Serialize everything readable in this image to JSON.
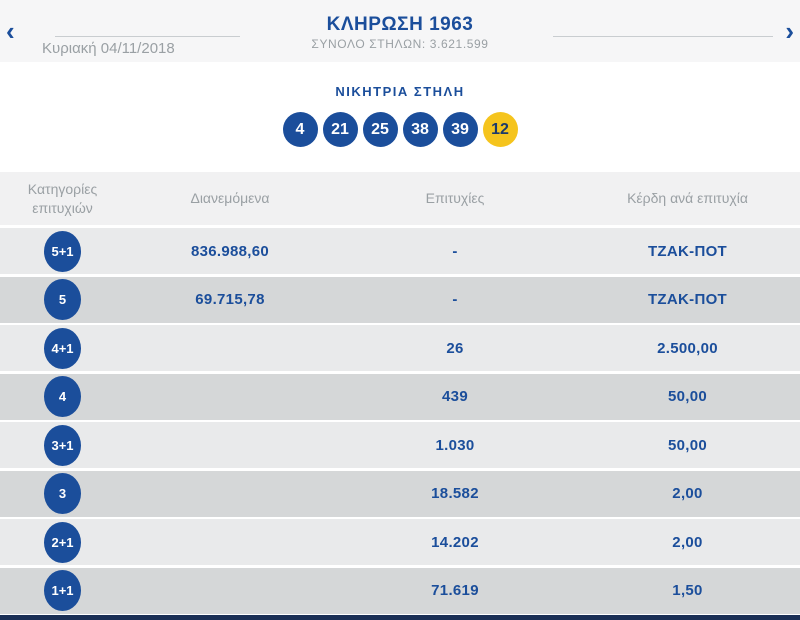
{
  "header": {
    "title": "ΚΛΗΡΩΣΗ 1963",
    "subtitle": "ΣΥΝΟΛΟ ΣΤΗΛΩΝ: 3.621.599",
    "date": "Κυριακή 04/11/2018",
    "prev_icon": "‹",
    "next_icon": "›"
  },
  "winning": {
    "title": "ΝΙΚΗΤΡΙΑ ΣΤΗΛΗ",
    "numbers": [
      "4",
      "21",
      "25",
      "38",
      "39"
    ],
    "bonus": "12"
  },
  "colors": {
    "navy": "#1b4e9b",
    "yellow": "#f5c41d",
    "footer_bar": "#1a2f55"
  },
  "table": {
    "headers": {
      "category_line1": "Κατηγορίες",
      "category_line2": "επιτυχιών",
      "amount": "Διανεμόμενα",
      "winners": "Επιτυχίες",
      "prize": "Κέρδη ανά επιτυχία"
    },
    "rows": [
      {
        "category": "5+1",
        "amount": "836.988,60",
        "winners": "-",
        "prize": "ΤΖΑΚ-ΠΟΤ"
      },
      {
        "category": "5",
        "amount": "69.715,78",
        "winners": "-",
        "prize": "ΤΖΑΚ-ΠΟΤ"
      },
      {
        "category": "4+1",
        "amount": "",
        "winners": "26",
        "prize": "2.500,00"
      },
      {
        "category": "4",
        "amount": "",
        "winners": "439",
        "prize": "50,00"
      },
      {
        "category": "3+1",
        "amount": "",
        "winners": "1.030",
        "prize": "50,00"
      },
      {
        "category": "3",
        "amount": "",
        "winners": "18.582",
        "prize": "2,00"
      },
      {
        "category": "2+1",
        "amount": "",
        "winners": "14.202",
        "prize": "2,00"
      },
      {
        "category": "1+1",
        "amount": "",
        "winners": "71.619",
        "prize": "1,50"
      }
    ]
  }
}
